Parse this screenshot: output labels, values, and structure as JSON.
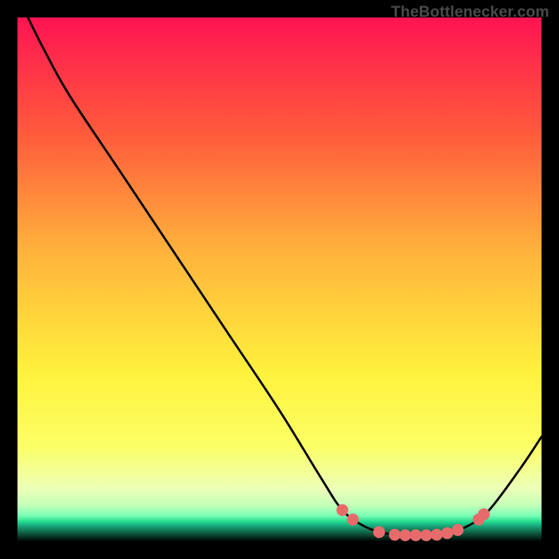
{
  "watermark": "TheBottlenecker.com",
  "chart_data": {
    "type": "line",
    "title": "",
    "xlabel": "",
    "ylabel": "",
    "xlim": [
      0,
      100
    ],
    "ylim": [
      0,
      100
    ],
    "grid": false,
    "curve": [
      {
        "x": 2,
        "y": 100
      },
      {
        "x": 5,
        "y": 94
      },
      {
        "x": 10,
        "y": 85
      },
      {
        "x": 20,
        "y": 70
      },
      {
        "x": 30,
        "y": 55
      },
      {
        "x": 40,
        "y": 40
      },
      {
        "x": 50,
        "y": 25
      },
      {
        "x": 58,
        "y": 12
      },
      {
        "x": 62,
        "y": 6
      },
      {
        "x": 66,
        "y": 3
      },
      {
        "x": 70,
        "y": 1.6
      },
      {
        "x": 74,
        "y": 1.2
      },
      {
        "x": 78,
        "y": 1.2
      },
      {
        "x": 82,
        "y": 1.6
      },
      {
        "x": 86,
        "y": 3
      },
      {
        "x": 90,
        "y": 6
      },
      {
        "x": 96,
        "y": 14
      },
      {
        "x": 100,
        "y": 20
      }
    ],
    "markers": [
      {
        "x": 62,
        "y": 6
      },
      {
        "x": 64,
        "y": 4.2
      },
      {
        "x": 69,
        "y": 1.8
      },
      {
        "x": 72,
        "y": 1.3
      },
      {
        "x": 74,
        "y": 1.2
      },
      {
        "x": 76,
        "y": 1.2
      },
      {
        "x": 78,
        "y": 1.2
      },
      {
        "x": 80,
        "y": 1.3
      },
      {
        "x": 82,
        "y": 1.6
      },
      {
        "x": 84,
        "y": 2.2
      },
      {
        "x": 88,
        "y": 4.2
      },
      {
        "x": 89,
        "y": 5.2
      }
    ],
    "marker_color": "#e86b6b",
    "curve_color": "#000000",
    "gradient_stops": [
      {
        "offset": 0,
        "color": "#ff1452"
      },
      {
        "offset": 22,
        "color": "#ff5a3c"
      },
      {
        "offset": 45,
        "color": "#ffb43c"
      },
      {
        "offset": 68,
        "color": "#fff23c"
      },
      {
        "offset": 82,
        "color": "#fbff66"
      },
      {
        "offset": 90,
        "color": "#ecffb8"
      },
      {
        "offset": 93,
        "color": "#c6ffb8"
      },
      {
        "offset": 95,
        "color": "#7dffb8"
      },
      {
        "offset": 96.3,
        "color": "#1dd98a"
      },
      {
        "offset": 96.6,
        "color": "#1dbf8a"
      },
      {
        "offset": 100,
        "color": "#000000"
      }
    ]
  }
}
